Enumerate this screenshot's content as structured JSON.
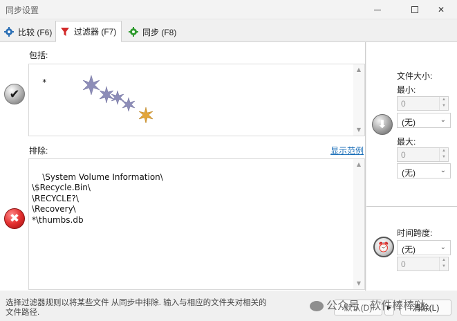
{
  "window": {
    "title": "同步设置",
    "close_glyph": "✕"
  },
  "tabs": [
    {
      "label": "比较 (F6)",
      "icon": "gear-icon",
      "color": "#2b6fb5"
    },
    {
      "label": "过滤器 (F7)",
      "icon": "funnel-icon",
      "color": "#d22a2a"
    },
    {
      "label": "同步 (F8)",
      "icon": "gear-green-icon",
      "color": "#2d9a2d"
    }
  ],
  "filter": {
    "include_label": "包括:",
    "include_text": "*",
    "exclude_label": "排除:",
    "show_example": "显示范例",
    "exclude_text": "\\System Volume Information\\\n\\$Recycle.Bin\\\n\\RECYCLE?\\\n\\Recovery\\\n*\\thumbs.db"
  },
  "file_size": {
    "label": "文件大小:",
    "min_label": "最小:",
    "min_value": "0",
    "min_unit": "(无)",
    "max_label": "最大:",
    "max_value": "0",
    "max_unit": "(无)"
  },
  "time_span": {
    "label": "时间跨度:",
    "unit": "(无)",
    "value": "0"
  },
  "footer": {
    "description": "选择过滤器规则以将某些文件 从同步中排除. 输入与相应的文件夹对相关的文件路径.",
    "default_button": "默认(D)",
    "clear_button": "清除(L)",
    "watermark": "公众号 · 软件棒棒哒"
  },
  "colors": {
    "link": "#1b6fb8",
    "accent_red": "#e33030"
  }
}
